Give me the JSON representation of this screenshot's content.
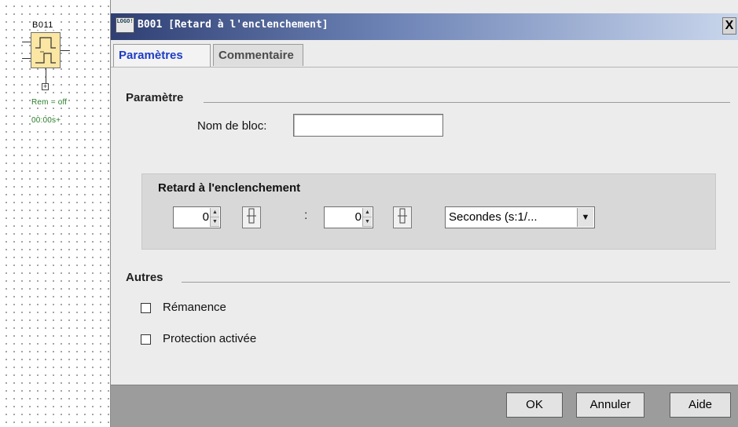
{
  "canvas": {
    "block_id": "B011",
    "rem_label": "Rem = off",
    "time_label": "00:00s+"
  },
  "dialog": {
    "title": "B001 [Retard à l'enclenchement]",
    "icon_label": "LOGO!",
    "close_label": "X",
    "tabs": [
      {
        "label": "Paramètres",
        "active": true
      },
      {
        "label": "Commentaire",
        "active": false
      }
    ],
    "parametre": {
      "section_title": "Paramètre",
      "block_name_label": "Nom de bloc:",
      "block_name_value": ""
    },
    "delay": {
      "group_title": "Retard à l'enclenchement",
      "value1": "0",
      "value2": "0",
      "separator": ":",
      "unit_selected": "Secondes (s:1/..."
    },
    "autres": {
      "section_title": "Autres",
      "options": [
        {
          "label": "Rémanence",
          "checked": false
        },
        {
          "label": "Protection activée",
          "checked": false
        }
      ]
    },
    "buttons": {
      "ok": "OK",
      "cancel": "Annuler",
      "help": "Aide"
    }
  }
}
